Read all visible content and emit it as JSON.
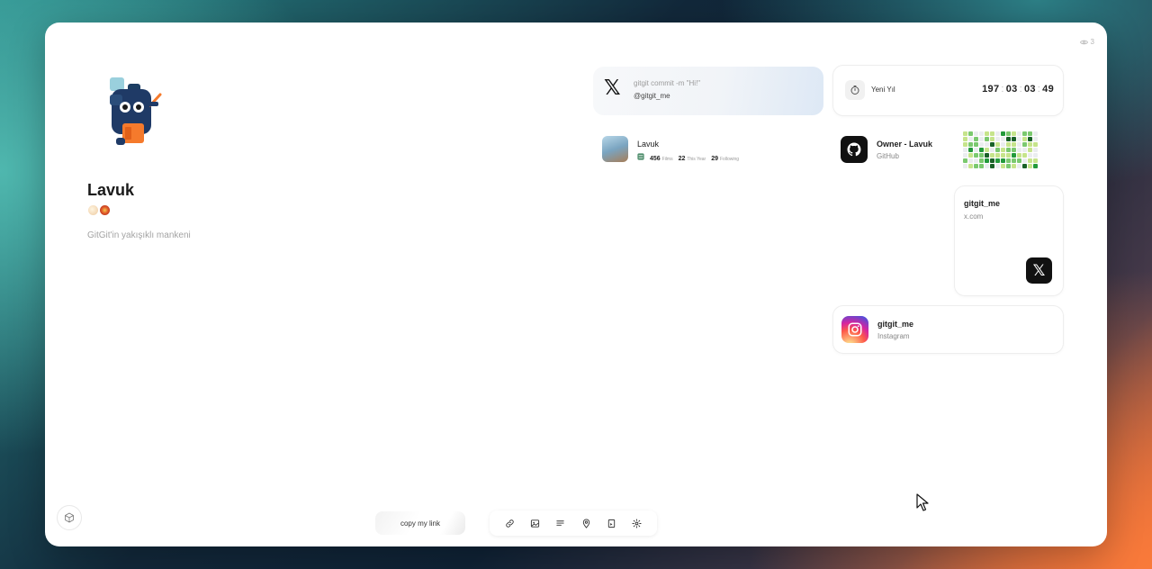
{
  "views": {
    "count": "3",
    "icon": "eye-icon"
  },
  "profile": {
    "name": "Lavuk",
    "bio": "GitGit'in yakışıklı mankeni",
    "emojis": [
      "hand-emoji",
      "flower-emoji"
    ]
  },
  "tweet": {
    "message": "gitgit commit -m \"Hi!\"",
    "handle": "@gitgit_me",
    "icon": "x-logo-icon"
  },
  "countdown": {
    "label": "Yeni Yıl",
    "days": "197",
    "hours": "03",
    "minutes": "03",
    "seconds": "49",
    "icon": "timer-icon"
  },
  "stats": {
    "name": "Lavuk",
    "items": [
      {
        "value": "456",
        "label": "Films"
      },
      {
        "value": "22",
        "label": "This Year"
      },
      {
        "value": "29",
        "label": "Following"
      }
    ]
  },
  "github": {
    "title": "Owner - Lavuk",
    "subtitle": "GitHub",
    "icon": "github-icon"
  },
  "xcom": {
    "title": "gitgit_me",
    "subtitle": "x.com",
    "icon": "x-logo-icon"
  },
  "instagram": {
    "title": "gitgit_me",
    "subtitle": "Instagram",
    "icon": "instagram-icon"
  },
  "bottom": {
    "copy_label": "copy my link",
    "tools": [
      "link-icon",
      "image-icon",
      "text-icon",
      "map-pin-icon",
      "media-icon",
      "settings-icon"
    ]
  },
  "colors": {
    "contrib_levels": [
      "#ebedf0",
      "#c6e48b",
      "#7bc96f",
      "#239a3b",
      "#196127"
    ]
  }
}
